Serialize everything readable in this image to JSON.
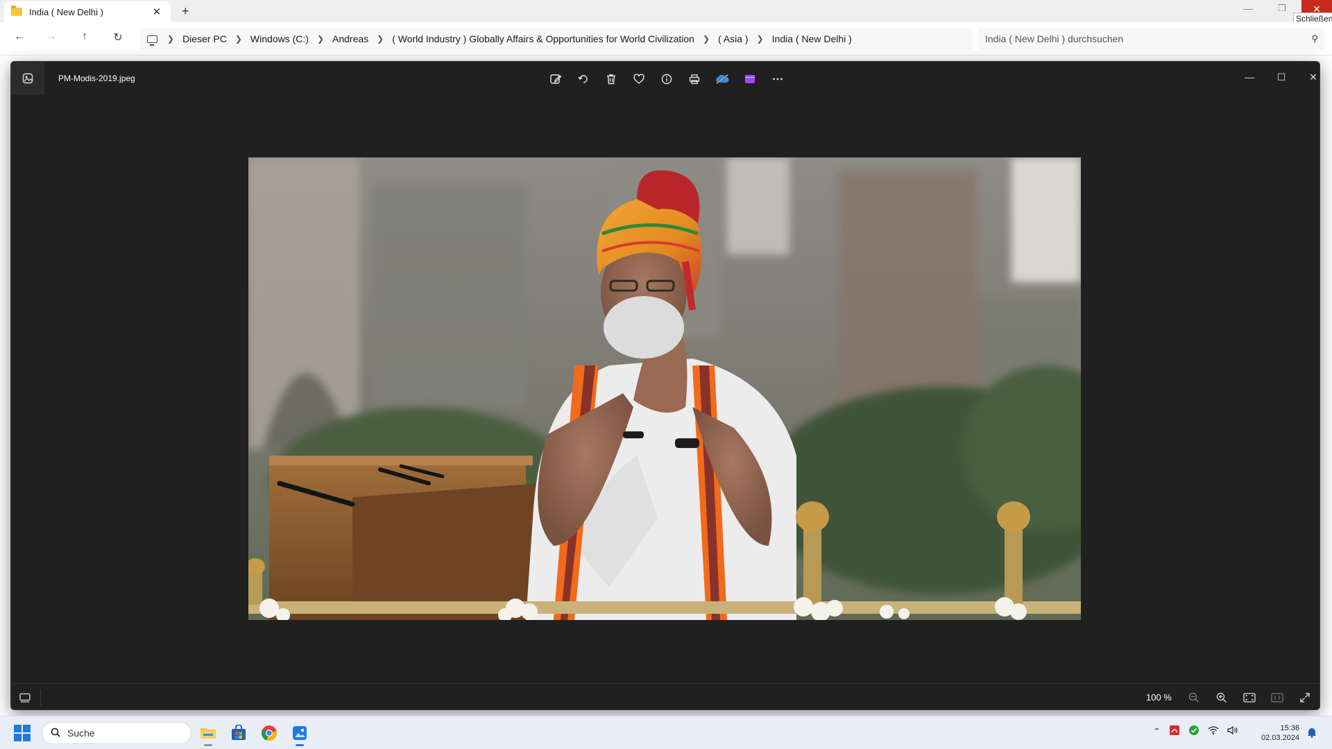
{
  "explorer": {
    "tab_title": "India ( New Delhi )",
    "tab_close": "✕",
    "new_tab": "+",
    "window_close_tooltip": "Schließen",
    "breadcrumbs": [
      "Dieser PC",
      "Windows (C:)",
      "Andreas",
      "( World Industry ) Globally Affairs & Opportunities for World Civilization",
      "( Asia )",
      "India ( New Delhi )"
    ],
    "search_placeholder": "India ( New Delhi ) durchsuchen"
  },
  "viewer": {
    "file_name": "PM-Modis-2019.jpeg",
    "toolbar_icons": [
      "edit-image-icon",
      "rotate-icon",
      "delete-icon",
      "favorite-heart-icon",
      "info-icon",
      "print-icon",
      "onedrive-icon",
      "clipchamp-icon",
      "more-options-icon"
    ],
    "zoom_level": "100 %"
  },
  "taskbar": {
    "search_label": "Suche",
    "time": "15:36",
    "date": "02.03.2024"
  },
  "colors": {
    "viewer_bg": "#202020",
    "accent": "#1f7ae0",
    "close_red": "#c42b1c"
  }
}
